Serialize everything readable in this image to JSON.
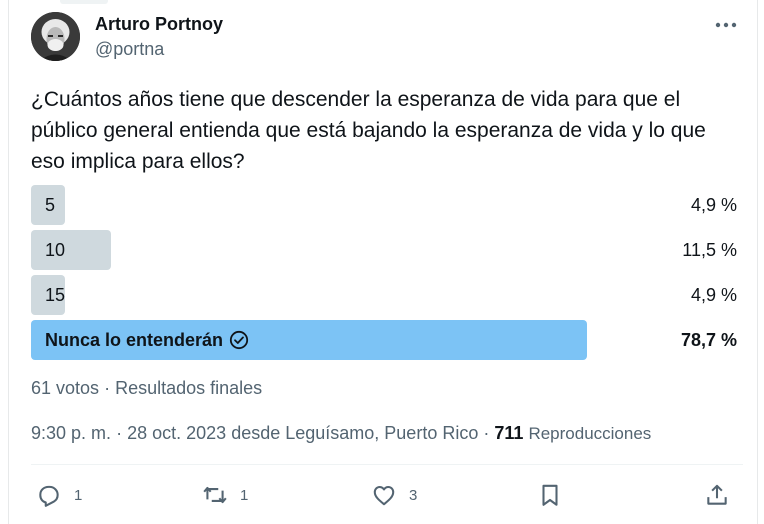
{
  "author": {
    "name": "Arturo Portnoy",
    "handle": "@portna"
  },
  "tweet": {
    "text": "¿Cuántos años tiene que descender la esperanza de vida para que el público general entienda que está bajando la esperanza de vida y lo que eso implica para ellos?"
  },
  "poll": {
    "options": [
      {
        "label": "5",
        "percent_text": "4,9 %",
        "percent": 4.9,
        "winner": false
      },
      {
        "label": "10",
        "percent_text": "11,5 %",
        "percent": 11.5,
        "winner": false
      },
      {
        "label": "15",
        "percent_text": "4,9 %",
        "percent": 4.9,
        "winner": false
      },
      {
        "label": "Nunca lo entenderán",
        "percent_text": "78,7 %",
        "percent": 78.7,
        "winner": true
      }
    ],
    "votes": "61 votos",
    "separator": "·",
    "status": "Resultados finales"
  },
  "meta": {
    "time": "9:30 p. m.",
    "date": "28 oct. 2023",
    "location": "desde Leguísamo, Puerto Rico",
    "views_count": "711",
    "views_label": "Reproducciones"
  },
  "actions": {
    "replies": "1",
    "reposts": "1",
    "likes": "3"
  },
  "colors": {
    "bar": "#cfd9de",
    "winner_bar": "#7cc3f5",
    "secondary_text": "#536471"
  },
  "icons": [
    "more-icon",
    "check-circle-icon",
    "reply-icon",
    "repost-icon",
    "like-icon",
    "bookmark-icon",
    "share-icon"
  ]
}
